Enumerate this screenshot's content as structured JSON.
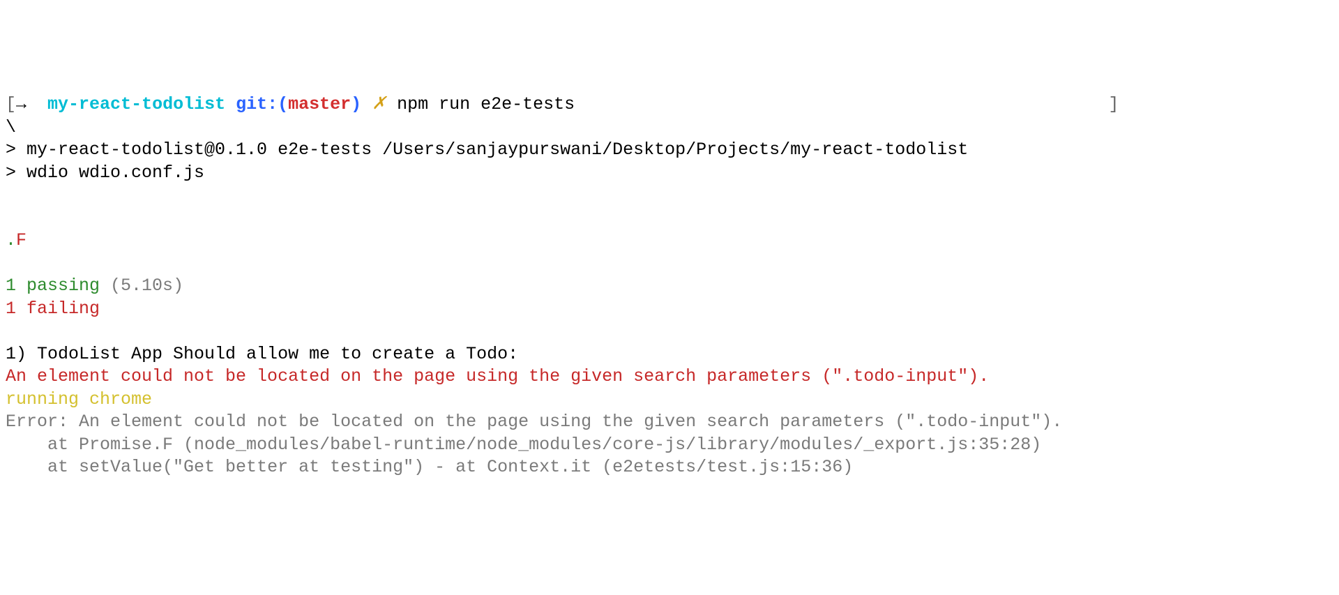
{
  "prompt": {
    "bracket_open": "[",
    "arrow": "→",
    "directory": "my-react-todolist",
    "git_label": "git:(",
    "branch": "master",
    "git_close": ")",
    "dirty_mark": "✗",
    "command": "npm run e2e-tests",
    "bracket_close": "]"
  },
  "backslash": "\\",
  "script_line1": "> my-react-todolist@0.1.0 e2e-tests /Users/sanjaypurswani/Desktop/Projects/my-react-todolist",
  "script_line2": "> wdio wdio.conf.js",
  "spec_dot": ".",
  "spec_fail": "F",
  "passing_count": "1",
  "passing_label": " passing",
  "passing_time": " (5.10s)",
  "failing_count": "1",
  "failing_label": " failing",
  "fail_title": "1) TodoList App Should allow me to create a Todo:",
  "fail_message": "An element could not be located on the page using the given search parameters (\".todo-input\").",
  "running_label": "running chrome",
  "stack_line1": "Error: An element could not be located on the page using the given search parameters (\".todo-input\").",
  "stack_line2": "    at Promise.F (node_modules/babel-runtime/node_modules/core-js/library/modules/_export.js:35:28)",
  "stack_line3": "    at setValue(\"Get better at testing\") - at Context.it (e2etests/test.js:15:36)"
}
